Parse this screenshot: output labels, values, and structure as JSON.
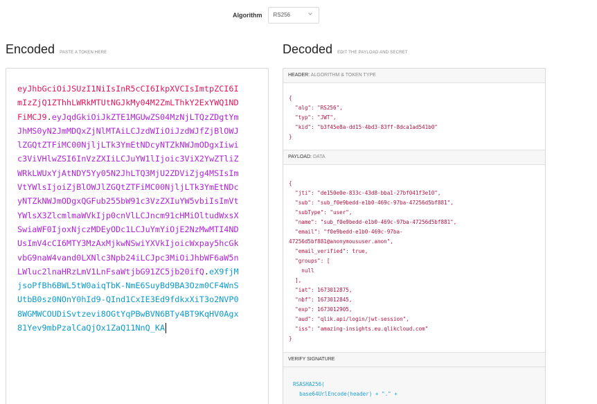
{
  "algorithm": {
    "label": "Algorithm",
    "selected": "RS256"
  },
  "encoded": {
    "title": "Encoded",
    "hint": "PASTE A TOKEN HERE",
    "token_header": "eyJhbGciOiJSUzI1NiIsInR5cCI6IkpXVCIsImtpZCI6ImIzZjQ1ZThhLWRkMTUtNGJkMy04M2ZmLThkY2ExYWQ1NDFiMCJ9",
    "dot1": ".",
    "token_payload": "eyJqdGkiOiJkZTE1MGUwZS04MzNjLTQzZDgtYmJhMS0yN2JmMDQxZjNlMTAiLCJzdWIiOiJzdWJfZjBlOWJlZGQtZTFiMC00NjljLTk3YmEtNDcyNTZkNWJmODgxIiwic3ViVHlwZSI6InVzZXIiLCJuYW1lIjoic3ViX2YwZTliZWRkLWUxYjAtNDY5Yy05N2JhLTQ3MjU2ZDViZjg4MSIsImVtYWlsIjoiZjBlOWJlZGQtZTFiMC00NjljLTk3YmEtNDcyNTZkNWJmODgxQGFub255bW91c3VzZXIuYW5vbiIsImVtYWlsX3ZlcmlmaWVkIjp0cnVlLCJncm91cHMiOltudWxsXSwiaWF0IjoxNjczMDEyODc1LCJuYmYiOjE2NzMwMTI4NDUsImV4cCI6MTY3MzAxMjkwNSwiYXVkIjoicWxpay5hcGkvbG9naW4vand0LXNlc3Npb24iLCJpc3MiOiJhbWF6aW5nLWluc2lnaHRzLmV1LnFsaWtjbG91ZC5jb20ifQ",
    "dot2": ".",
    "token_signature": "eX9fjMjsoPfBh6BWL5tW0aiqTbK-NmE6SuyBd9BA3Ozm0CF4WnSUtbB0sz0NOnY0hId9-QInd1CxIE3Ed9fdkxXiT3o2NVP08WGMWCOUDiSvtzevi8OGtYqPBwBVN6BTy4BT9KqHV0Agx81Yev9mbPzalCaQjOx1ZaQ11NnQ_KA"
  },
  "decoded": {
    "title": "Decoded",
    "hint": "EDIT THE PAYLOAD AND SECRET",
    "header_panel": {
      "label": "HEADER:",
      "sub": "ALGORITHM & TOKEN TYPE",
      "json": "{\n  \"alg\": \"RS256\",\n  \"typ\": \"JWT\",\n  \"kid\": \"b3f45e8a-dd15-4bd3-83ff-8dca1ad541b0\"\n}"
    },
    "payload_panel": {
      "label": "PAYLOAD:",
      "sub": "DATA",
      "json": "{\n  \"jti\": \"de150e0e-833c-43d8-bba1-27bf041f3e10\",\n  \"sub\": \"sub_f0e9bedd-e1b0-469c-97ba-47256d5bf881\",\n  \"subType\": \"user\",\n  \"name\": \"sub_f0e9bedd-e1b0-469c-97ba-47256d5bf881\",\n  \"email\": \"f0e9bedd-e1b0-469c-97ba-\n47256d5bf881@anonymoususer.anon\",\n  \"email_verified\": true,\n  \"groups\": [\n    null\n  ],\n  \"iat\": 1673012875,\n  \"nbf\": 1673012845,\n  \"exp\": 1673012905,\n  \"aud\": \"qlik.api/login/jwt-session\",\n  \"iss\": \"amazing-insights.eu.qlikcloud.com\"\n}"
    },
    "verify_panel": {
      "label": "VERIFY SIGNATURE",
      "code": "RSASHA256(\n  base64UrlEncode(header) + \".\" +"
    }
  }
}
